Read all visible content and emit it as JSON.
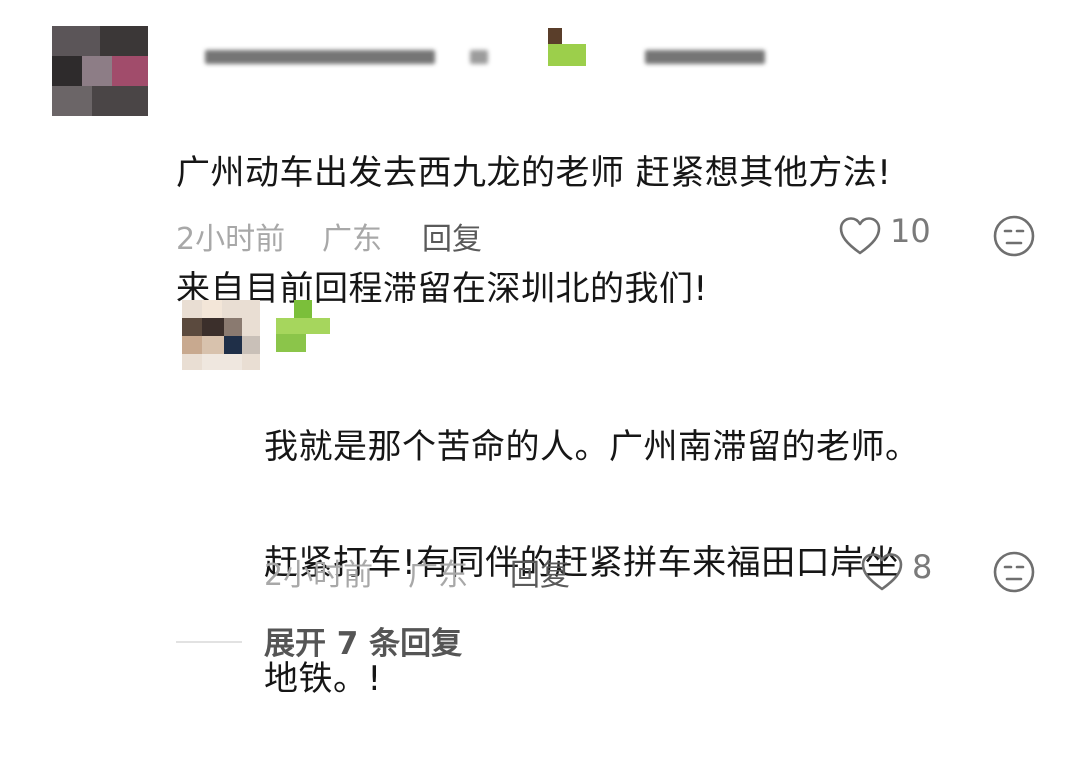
{
  "comments": [
    {
      "text_line1": "广州动车出发去西九龙的老师 赶紧想其他方法!",
      "text_line2": "来自目前回程滞留在深圳北的我们!",
      "time": "2小时前",
      "region": "广东",
      "reply_label": "回复",
      "likes": "10"
    }
  ],
  "reply": {
    "text_line1": "我就是那个苦命的人。广州南滞留的老师。",
    "text_line2": "赶紧打车!有同伴的赶紧拼车来福田口岸坐",
    "text_line3": "地铁。!",
    "time": "2小时前",
    "region": "广东",
    "reply_label": "回复",
    "likes": "8"
  },
  "expand_label": "展开 7 条回复",
  "icons": {
    "like": "heart-outline-icon",
    "reaction": "neutral-face-icon"
  }
}
